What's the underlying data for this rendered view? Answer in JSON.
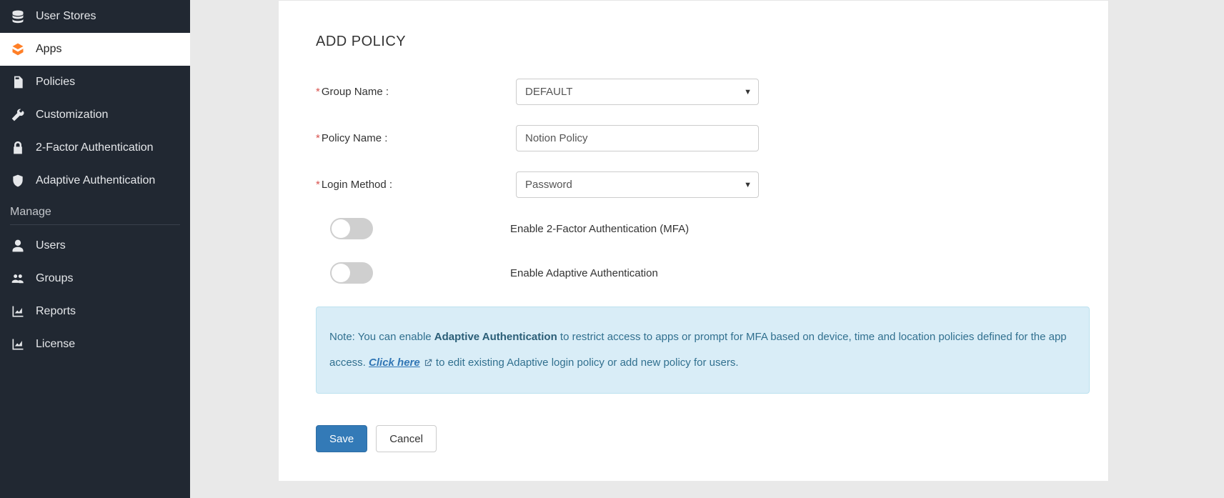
{
  "sidebar": {
    "items": [
      {
        "label": "User Stores"
      },
      {
        "label": "Apps"
      },
      {
        "label": "Policies"
      },
      {
        "label": "Customization"
      },
      {
        "label": "2-Factor Authentication"
      },
      {
        "label": "Adaptive Authentication"
      }
    ],
    "section_header": "Manage",
    "manage_items": [
      {
        "label": "Users"
      },
      {
        "label": "Groups"
      },
      {
        "label": "Reports"
      },
      {
        "label": "License"
      }
    ]
  },
  "form": {
    "title": "ADD POLICY",
    "group_name_label": "Group Name :",
    "group_name_value": "DEFAULT",
    "policy_name_label": "Policy Name :",
    "policy_name_value": "Notion Policy",
    "login_method_label": "Login Method :",
    "login_method_value": "Password",
    "toggle_mfa_label": "Enable 2-Factor Authentication (MFA)",
    "toggle_adaptive_label": "Enable Adaptive Authentication",
    "note_prefix": "Note: You can enable ",
    "note_bold": "Adaptive Authentication",
    "note_mid": " to restrict access to apps or prompt for MFA based on device, time and location policies defined for the app access. ",
    "note_link": "Click here",
    "note_suffix": " to edit existing Adaptive login policy or add new policy for users.",
    "save_label": "Save",
    "cancel_label": "Cancel"
  }
}
